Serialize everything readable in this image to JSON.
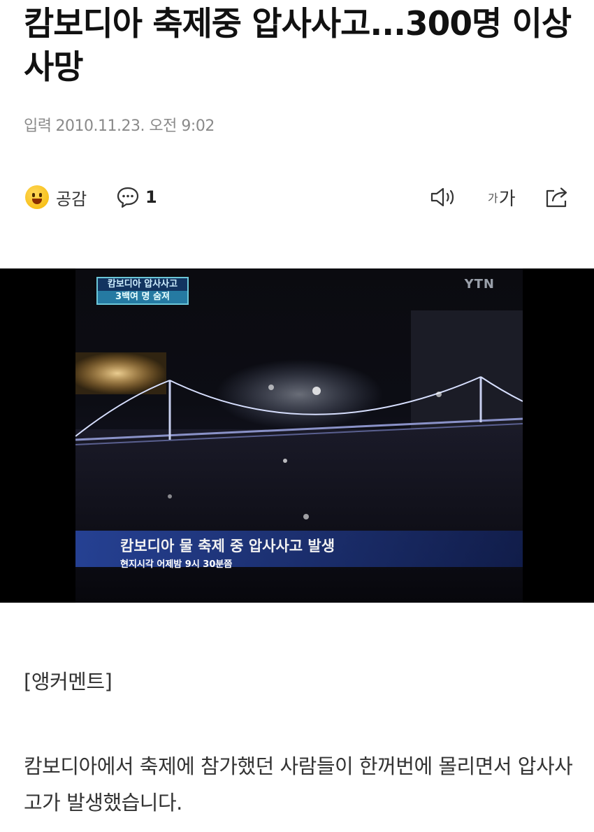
{
  "article": {
    "headline": "캄보디아 축제중 압사사고...300명 이상 사망",
    "meta_label": "입력",
    "date": "2010.11.23. 오전 9:02"
  },
  "toolbar": {
    "like_label": "공감",
    "comment_count": "1",
    "font_small": "가",
    "font_large": "가"
  },
  "video": {
    "caption_top_line1": "캄보디아 압사사고",
    "caption_top_line2": "3백여 명 숨져",
    "logo": "YTN",
    "lower_third_title": "캄보디아 물 축제 중 압사사고 발생",
    "lower_third_sub": "현지시각 어제밤 9시 30분쯤"
  },
  "body": {
    "section_label": "[앵커멘트]",
    "paragraph": "캄보디아에서 축제에 참가했던 사람들이 한꺼번에 몰리면서 압사사고가 발생했습니다."
  }
}
